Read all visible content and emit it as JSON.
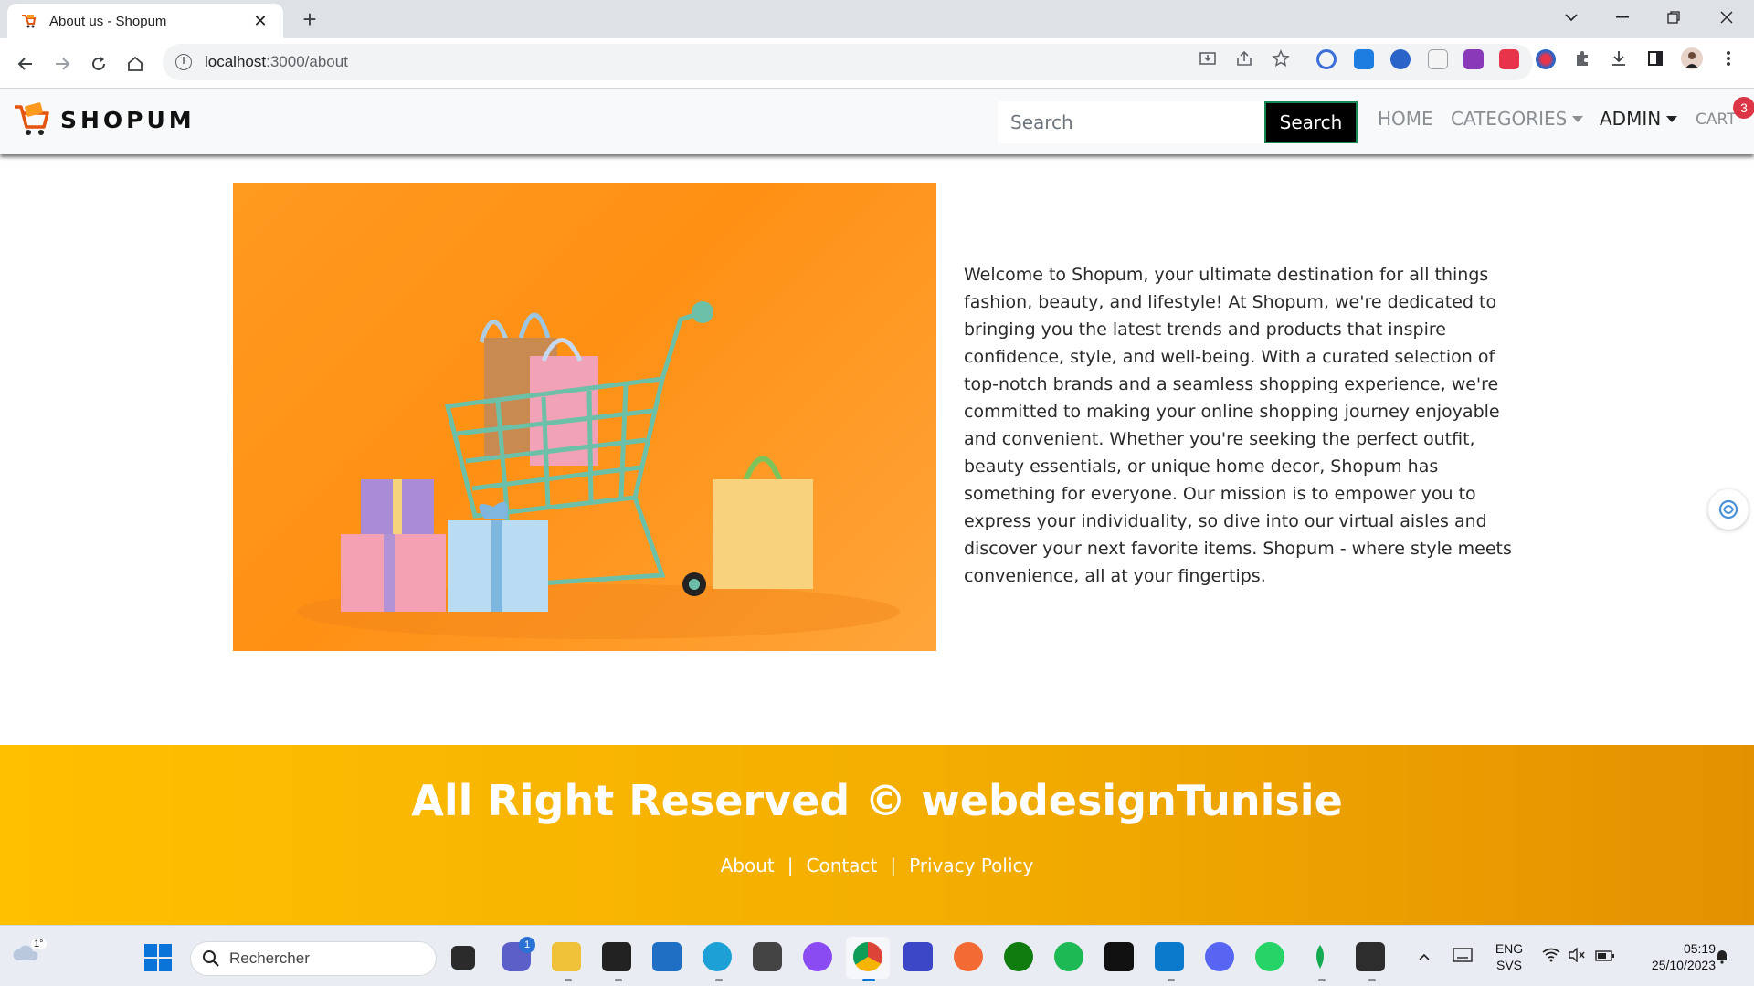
{
  "browser": {
    "tab_title": "About us - Shopum",
    "url_host": "localhost",
    "url_path": ":3000/about"
  },
  "header": {
    "brand": "SHOPUM",
    "search_placeholder": "Search",
    "search_button": "Search",
    "nav": {
      "home": "HOME",
      "categories": "CATEGORIES",
      "admin": "ADMIN",
      "cart": "CART",
      "cart_count": "3"
    }
  },
  "about": {
    "text": "Welcome to Shopum, your ultimate destination for all things fashion, beauty, and lifestyle! At Shopum, we're dedicated to bringing you the latest trends and products that inspire confidence, style, and well-being. With a curated selection of top-notch brands and a seamless shopping experience, we're committed to making your online shopping journey enjoyable and convenient. Whether you're seeking the perfect outfit, beauty essentials, or unique home decor, Shopum has something for everyone. Our mission is to empower you to express your individuality, so dive into our virtual aisles and discover your next favorite items. Shopum - where style meets convenience, all at your fingertips."
  },
  "footer": {
    "title": "All Right Reserved © webdesignTunisie",
    "links": [
      "About",
      "Contact",
      "Privacy Policy"
    ],
    "separator": "|"
  },
  "taskbar": {
    "weather_temp": "1°",
    "search_label": "Rechercher",
    "teams_badge": "1",
    "lang_top": "ENG",
    "lang_bottom": "SVS",
    "time": "05:19",
    "date": "25/10/2023"
  },
  "colors": {
    "footer_start": "#ffc000",
    "footer_end": "#e49100",
    "hero_bg": "#ff9a1f",
    "badge": "#dc3545"
  }
}
